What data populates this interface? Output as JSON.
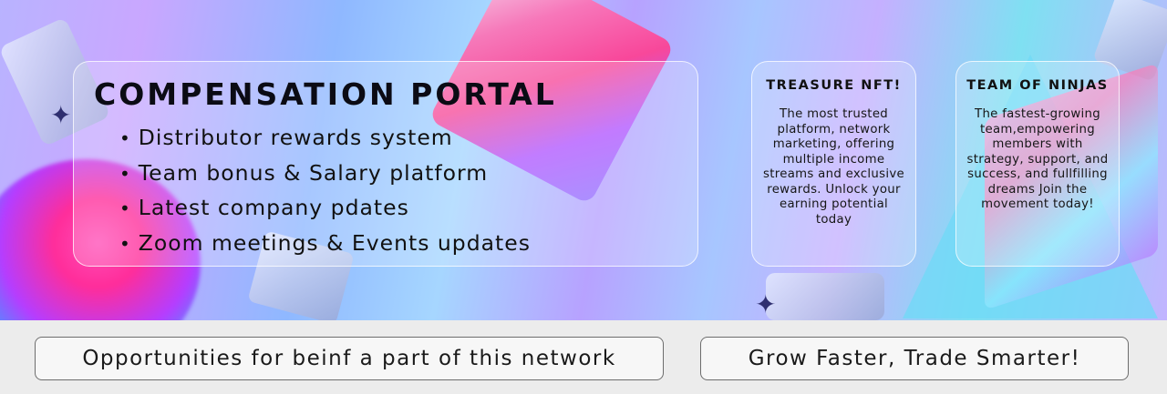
{
  "portal": {
    "title": "COMPENSATION PORTAL",
    "items": [
      "Distributor rewards system",
      "Team bonus & Salary platform",
      "Latest company pdates",
      "Zoom meetings & Events updates"
    ]
  },
  "cards": [
    {
      "title": "TREASURE NFT!",
      "text": "The most trusted platform, network marketing, offering multiple income streams and exclusive rewards. Unlock your earning potential today"
    },
    {
      "title": "TEAM OF NINJAS",
      "text": "The fastest-growing team,empowering members with strategy, support, and success, and fullfilling dreams Join the movement today!"
    }
  ],
  "buttons": {
    "opportunities_label": "Opportunities for beinf a part of this network",
    "grow_label": "Grow Faster, Trade Smarter!"
  },
  "icons": [
    "sparkle-icon"
  ],
  "colors": {
    "text": "#111111",
    "button_border": "#6d6d6d",
    "page_background": "#ececec"
  }
}
